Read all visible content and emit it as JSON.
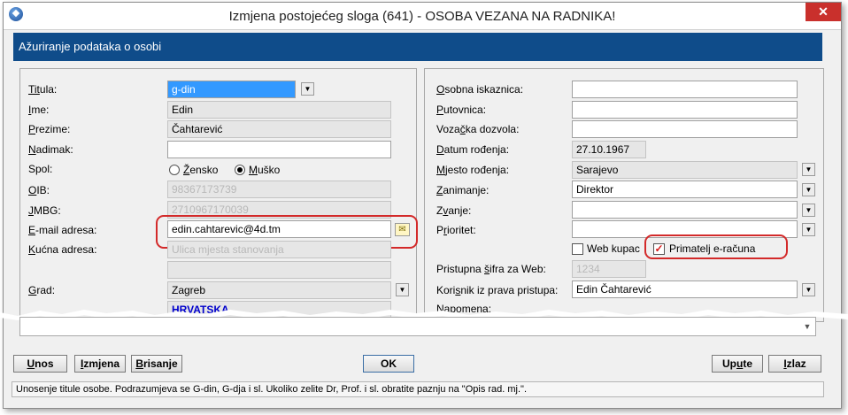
{
  "window": {
    "title": "Izmjena postojećeg sloga (641) - OSOBA VEZANA NA RADNIKA!",
    "close_glyph": "✕"
  },
  "section": {
    "header": "Ažuriranje podataka o osobi"
  },
  "left": {
    "titula": {
      "label_u": "Tit",
      "label_rest": "ula:",
      "value": "g-din",
      "btn_icon": "dropdown-arrow-icon"
    },
    "ime": {
      "label_u": "I",
      "label_rest": "me:",
      "value": "Edin"
    },
    "prezime": {
      "label_u": "P",
      "label_rest": "rezime:",
      "value": "Čahtarević"
    },
    "nadimak": {
      "label_u": "N",
      "label_rest": "adimak:",
      "value": ""
    },
    "spol": {
      "label": "Spol:",
      "option1": "Žensko",
      "option1_u": "Ž",
      "option1_rest": "ensko",
      "option2": "Muško",
      "option2_u": "M",
      "option2_rest": "uško",
      "selected": "Muško"
    },
    "oib": {
      "label_u": "O",
      "label_rest": "IB:",
      "value": "98367173739"
    },
    "jmbg": {
      "label_u": "J",
      "label_rest": "MBG:",
      "value": "2710967170039"
    },
    "email": {
      "label_u": "E",
      "label_rest": "-mail adresa:",
      "value": "edin.cahtarevic@4d.tm",
      "btn_icon": "envelope-icon"
    },
    "kucna": {
      "label_u": "K",
      "label_rest": "ućna adresa:",
      "value": "Ulica mjesta stanovanja"
    },
    "grad": {
      "label_u": "G",
      "label_rest": "rad:",
      "value": "Zagreb",
      "country": "HRVATSKA"
    }
  },
  "right": {
    "osobna": {
      "label_u": "O",
      "label_rest": "sobna iskaznica:",
      "value": ""
    },
    "putovnica": {
      "label_u": "P",
      "label_rest": "utovnica:",
      "value": ""
    },
    "vozacka": {
      "label_pre": "Voza",
      "label_u": "č",
      "label_rest": "ka dozvola:",
      "value": ""
    },
    "datum": {
      "label_u": "D",
      "label_rest": "atum rođenja:",
      "value": "27.10.1967"
    },
    "mjesto": {
      "label_u": "M",
      "label_rest": "jesto rođenja:",
      "value": "Sarajevo"
    },
    "zanimanje": {
      "label_u": "Z",
      "label_rest": "animanje:",
      "value": "Direktor"
    },
    "zvanje": {
      "label_pre": "Z",
      "label_u": "v",
      "label_rest": "anje:",
      "value": ""
    },
    "prioritet": {
      "label_pre": "P",
      "label_u": "r",
      "label_rest": "ioritet:",
      "value": ""
    },
    "web_kupac": {
      "label": "Web kupac",
      "checked": false
    },
    "primatelj": {
      "label": "Primatelj e-računa",
      "checked": true,
      "check_glyph": "✓"
    },
    "pristupna": {
      "label_pre": "Pristupna ",
      "label_u": "š",
      "label_rest": "ifra za Web:",
      "value": "1234"
    },
    "korisnik": {
      "label_pre": "Kori",
      "label_u": "s",
      "label_rest": "nik iz prava pristupa:",
      "value": "Edin Čahtarević"
    },
    "napomena": {
      "label_u": "N",
      "label_rest": "apomena:"
    }
  },
  "buttons": {
    "unos": {
      "label_u": "U",
      "label_rest": "nos"
    },
    "izmjena": {
      "label_u": "I",
      "label_rest": "zmjena"
    },
    "brisanje": {
      "label_u": "B",
      "label_rest": "risanje"
    },
    "ok": "OK",
    "upute": {
      "label_pre": "Up",
      "label_u": "u",
      "label_rest": "te"
    },
    "izlaz": {
      "label_u": "I",
      "label_rest": "zlaz"
    }
  },
  "status": "Unosenje titule osobe. Podrazumjeva se G-din, G-dja i sl. Ukoliko zelite Dr, Prof. i sl. obratite paznju na \"Opis rad. mj.\".",
  "colors": {
    "header_bg": "#0f4c8a",
    "highlight": "#d32a2a",
    "selection": "#3399ff",
    "close": "#c9302c"
  }
}
